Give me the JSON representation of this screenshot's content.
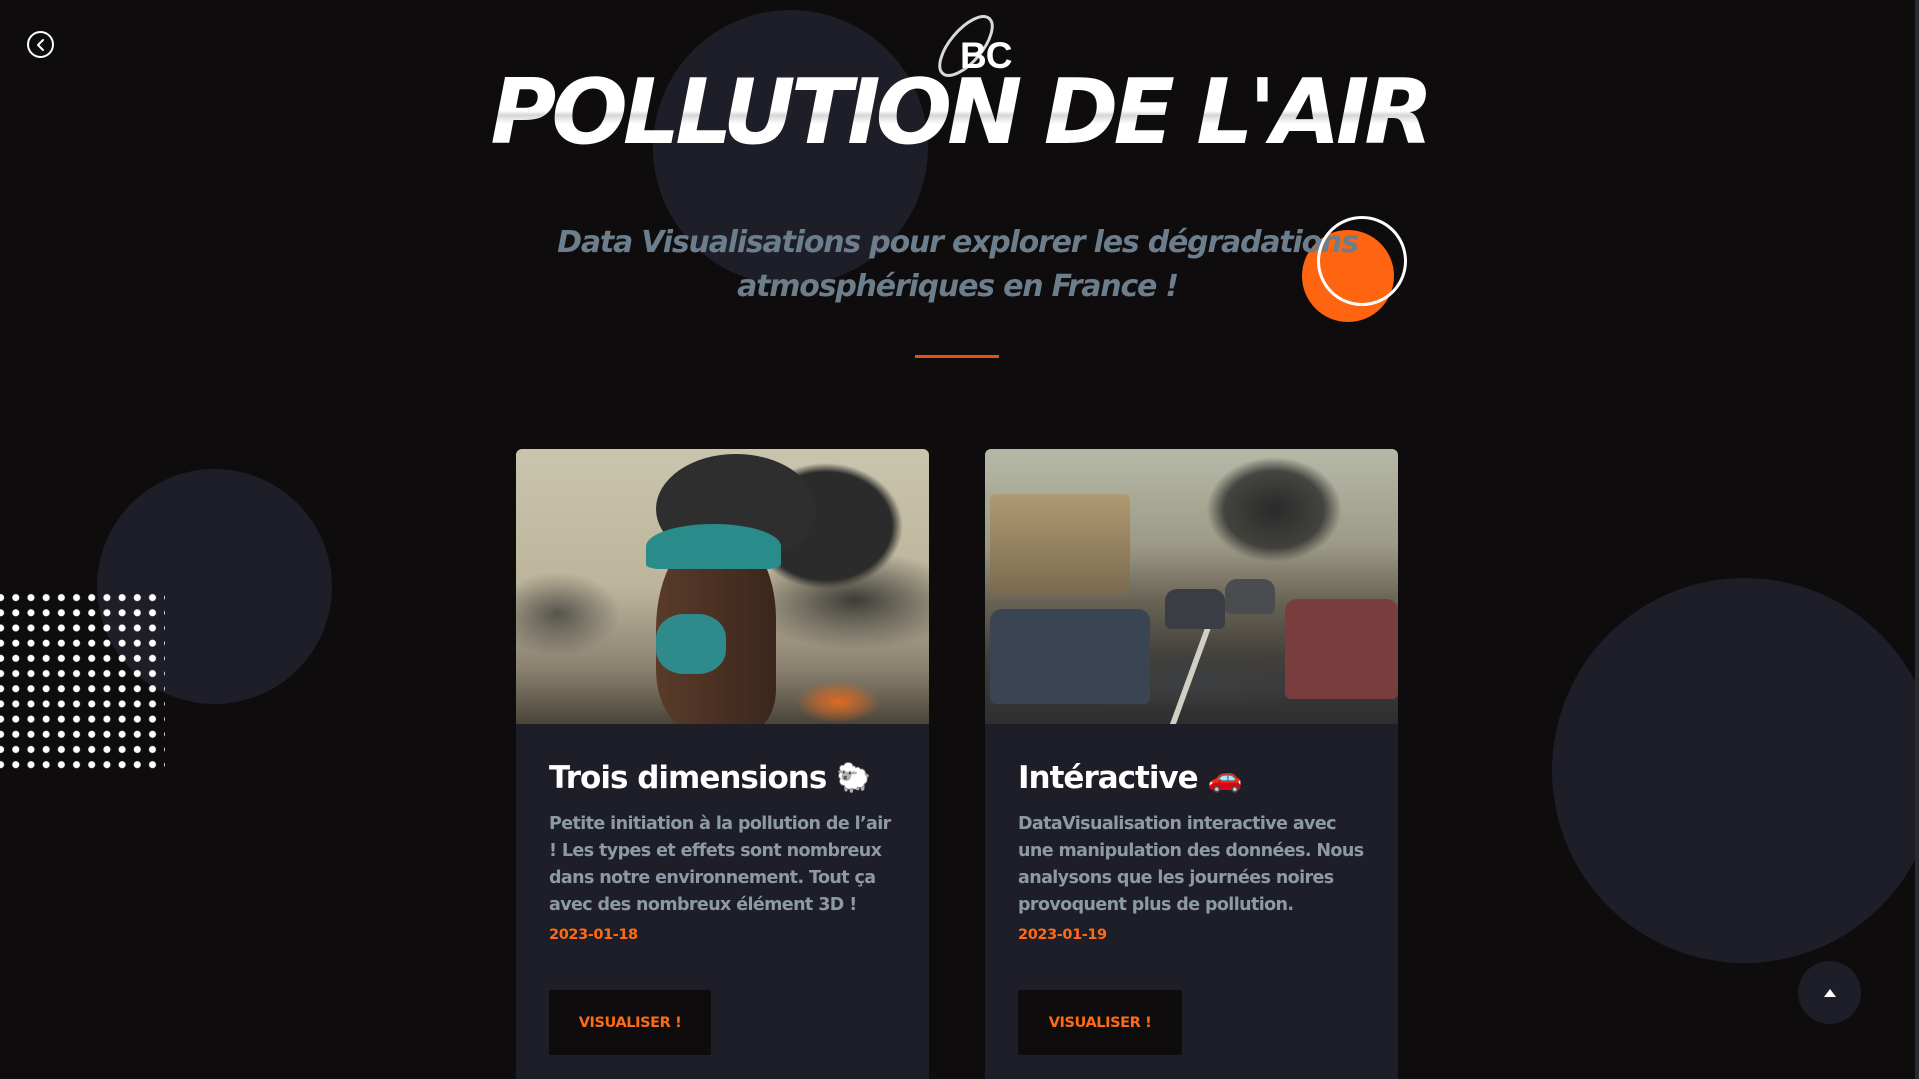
{
  "header": {
    "logo_text": "BC",
    "title": "POLLUTION DE L'AIR",
    "subtitle": "Data Visualisations pour explorer les dégradations atmosphériques en France !"
  },
  "nav": {
    "back_icon": "chevron-left-icon",
    "scroll_top_icon": "arrow-up-icon"
  },
  "cards": [
    {
      "title": "Trois dimensions",
      "emoji": "🐑",
      "description": "Petite initiation à la pollution de l’air ! Les types et effets sont nombreux dans notre environnement. Tout ça avec des nombreux élément 3D !",
      "date": "2023-01-18",
      "button_label": "VISUALISER !"
    },
    {
      "title": "Intéractive",
      "emoji": "🚗",
      "description": "DataVisualisation interactive avec une manipulation des données. Nous analysons que les journées noires provoquent plus de pollution.",
      "date": "2023-01-19",
      "button_label": "VISUALISER !"
    }
  ],
  "colors": {
    "background": "#0f0c0d",
    "card_background": "#1d1e27",
    "accent": "#ff6a14",
    "subtitle": "#6c7e8c",
    "text_muted": "#8d9aa6"
  }
}
